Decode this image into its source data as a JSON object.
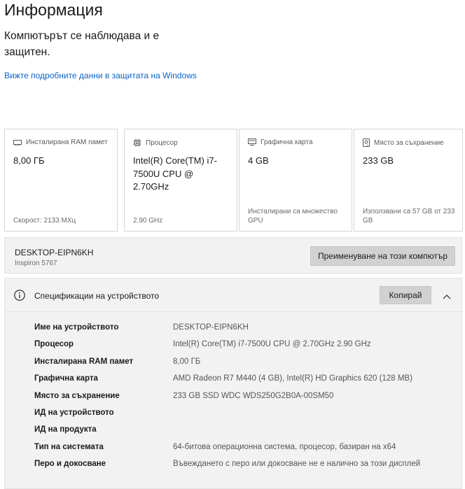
{
  "header": {
    "title": "Информация",
    "protection_status": "Компютърът се наблюдава и е защитен.",
    "security_link": "Вижте подробните данни в защитата на Windows"
  },
  "cards": [
    {
      "icon": "ram-icon",
      "label": "Инсталирана RAM памет",
      "value": "8,00 ГБ",
      "footer": "Скорост: 2133 МХц"
    },
    {
      "icon": "processor-icon",
      "label": "Процесор",
      "value": "Intel(R) Core(TM) i7-7500U CPU @ 2.70GHz",
      "footer": "2.90 GHz"
    },
    {
      "icon": "graphics-card-icon",
      "label": "Графична карта",
      "value": "4 GB",
      "footer": "Инсталирани са множество GPU"
    },
    {
      "icon": "storage-icon",
      "label": "Място за съхранение",
      "value": "233 GB",
      "footer": "Използвани са 57 GB от 233 GB"
    }
  ],
  "device": {
    "name": "DESKTOP-EIPN6KH",
    "model": "Inspiron 5767",
    "rename_label": "Преименуване на този компютър"
  },
  "specs": {
    "title": "Спецификации на устройството",
    "copy_label": "Копирай",
    "rows": [
      {
        "key": "Име на устройството",
        "value": "DESKTOP-EIPN6KH"
      },
      {
        "key": "Процесор",
        "value": "Intel(R) Core(TM) i7-7500U CPU @ 2.70GHz   2.90 GHz"
      },
      {
        "key": "Инсталирана RAM памет",
        "value": "8,00 ГБ"
      },
      {
        "key": "Графична карта",
        "value": "AMD Radeon R7 M440 (4 GB), Intel(R) HD Graphics 620 (128 MB)"
      },
      {
        "key": "Място за съхранение",
        "value": "233 GB SSD WDC WDS250G2B0A-00SM50"
      },
      {
        "key": "ИД на устройството",
        "value": ""
      },
      {
        "key": "ИД на продукта",
        "value": ""
      },
      {
        "key": "Тип на системата",
        "value": "64-битова операционна система, процесор, базиран на x64"
      },
      {
        "key": "Перо и докосване",
        "value": "Въвеждането с перо или докосване не е налично за този дисплей"
      }
    ]
  },
  "colors": {
    "link": "#0a62c4",
    "panel": "#f2f2f2",
    "button": "#d1d1d1"
  }
}
